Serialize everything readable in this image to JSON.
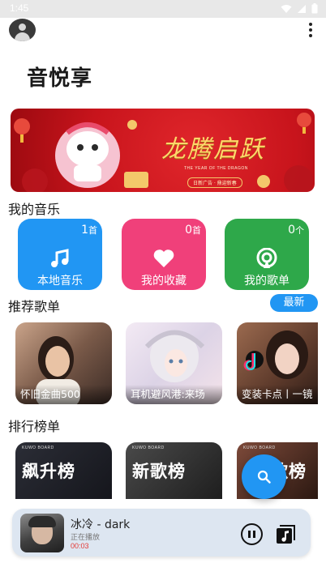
{
  "status_bar": {
    "time": "1:45",
    "icons": [
      "wifi-icon",
      "signal-icon",
      "battery-icon"
    ]
  },
  "header": {
    "avatar": "user-avatar",
    "menu_icon": "more-vert-icon"
  },
  "app": {
    "title": "音悦享"
  },
  "banner": {
    "slogan": "龙腾启跃",
    "subtitle": "THE YEAR OF THE DRAGON",
    "tag": "日新广告 · 鼎迎新春"
  },
  "my_music": {
    "heading": "我的音乐",
    "tiles": [
      {
        "label": "本地音乐",
        "count": "1",
        "unit": "首",
        "color": "#2196f3",
        "icon": "music-note-icon"
      },
      {
        "label": "我的收藏",
        "count": "0",
        "unit": "首",
        "color": "#f0407a",
        "icon": "heart-icon"
      },
      {
        "label": "我的歌单",
        "count": "0",
        "unit": "个",
        "color": "#2ea84a",
        "icon": "podcast-icon"
      }
    ]
  },
  "recommended": {
    "heading": "推荐歌单",
    "badge": "最新",
    "playlists": [
      {
        "title": "怀旧金曲500"
      },
      {
        "title": "耳机避风港:来场"
      },
      {
        "title": "变装卡点丨一镜"
      }
    ]
  },
  "charts": {
    "heading": "排行榜单",
    "lists": [
      {
        "name": "飙升榜",
        "brand": "KUWO BOARD"
      },
      {
        "name": "新歌榜",
        "brand": "KUWO BOARD"
      },
      {
        "name": "热歌榜",
        "brand": "KUWO BOARD"
      }
    ]
  },
  "fab": {
    "icon": "search-icon",
    "color": "#2196f3"
  },
  "now_playing": {
    "title": "冰冷 - dark",
    "status": "正在播放",
    "elapsed": "00:03",
    "controls": [
      "pause-icon",
      "playlist-icon"
    ]
  }
}
